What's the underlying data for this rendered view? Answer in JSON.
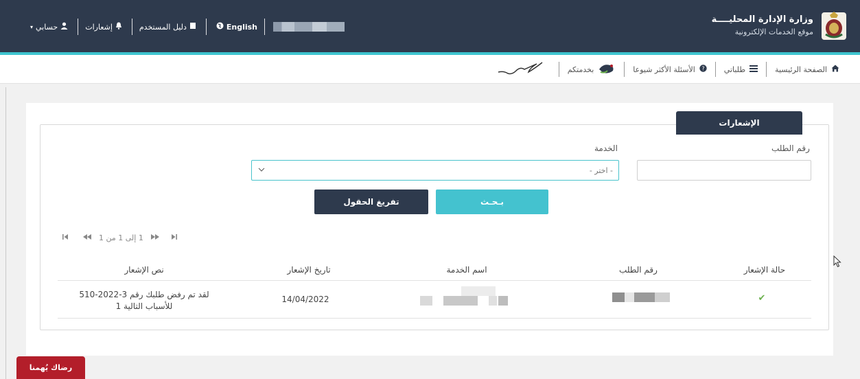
{
  "header": {
    "ministry_title": "وزارة الإدارة المحليــــة",
    "portal_subtitle": "موقع الخدمات الإلكترونية",
    "nav": {
      "account": "حسابي",
      "notifications": "إشعارات",
      "user_guide": "دليل المستخدم",
      "language": "English"
    }
  },
  "subnav": {
    "home": "الصفحة الرئيسية",
    "my_requests": "طلباتي",
    "faq": "الأسئلة الأكثر شيوعا",
    "at_your_service": "بخدمتكم"
  },
  "tab": {
    "label": "الإشعارات"
  },
  "form": {
    "request_number_label": "رقم الطلب",
    "service_label": "الخدمة",
    "service_placeholder": "- اختر -",
    "search_button": "بـحـث",
    "clear_button": "تفريغ الحقول"
  },
  "pager": {
    "summary": "1 إلى 1 من 1"
  },
  "table": {
    "headers": [
      "حالة الإشعار",
      "رقم الطلب",
      "اسم الخدمة",
      "تاريخ الإشعار",
      "نص الإشعار"
    ],
    "rows": [
      {
        "status": "✔",
        "date": "14/04/2022",
        "text_line1": "لقد تم رفض طلبك رقم 3-2022-510",
        "text_line2": "للأسباب التالية 1"
      }
    ]
  },
  "feedback": {
    "label": "رضاك يُهمنا"
  },
  "colors": {
    "navy": "#2e3a4d",
    "teal": "#44c2cf",
    "red": "#b31e2a",
    "check_green": "#6ab04c"
  }
}
